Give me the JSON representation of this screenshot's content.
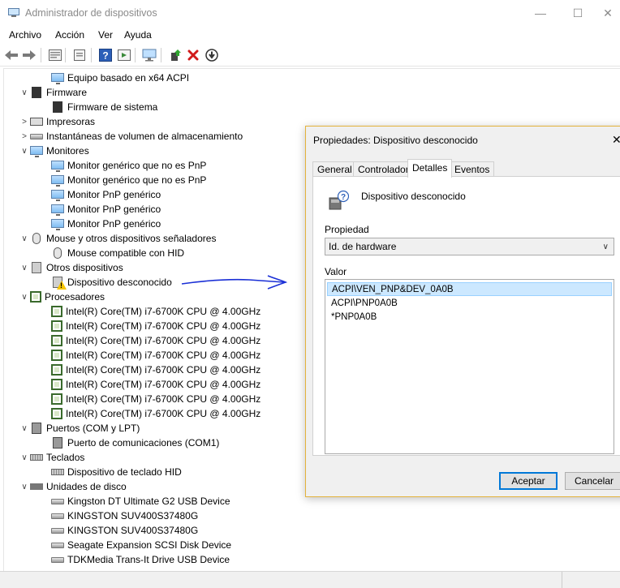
{
  "window": {
    "title": "Administrador de dispositivos",
    "minimize": "—",
    "maximize": "☐",
    "close": "✕"
  },
  "menu": [
    "Archivo",
    "Acción",
    "Ver",
    "Ayuda"
  ],
  "toolbar": [
    "back-icon",
    "forward-icon",
    "properties-icon",
    "refresh-icon",
    "help-icon",
    "run-icon",
    "monitor-icon",
    "update-driver-icon",
    "uninstall-icon",
    "download-icon"
  ],
  "tree": [
    {
      "label": "Equipo basado en x64 ACPI",
      "level": 2,
      "icon": "monitor",
      "expander": ""
    },
    {
      "label": "Firmware",
      "level": 1,
      "icon": "firmware",
      "expander": "∨"
    },
    {
      "label": "Firmware de sistema",
      "level": 2,
      "icon": "firmware",
      "expander": ""
    },
    {
      "label": "Impresoras",
      "level": 1,
      "icon": "printer",
      "expander": ">"
    },
    {
      "label": "Instantáneas de volumen de almacenamiento",
      "level": 1,
      "icon": "drive",
      "expander": ">"
    },
    {
      "label": "Monitores",
      "level": 1,
      "icon": "monitor",
      "expander": "∨"
    },
    {
      "label": "Monitor genérico que no es PnP",
      "level": 2,
      "icon": "monitor",
      "expander": ""
    },
    {
      "label": "Monitor genérico que no es PnP",
      "level": 2,
      "icon": "monitor",
      "expander": ""
    },
    {
      "label": "Monitor PnP genérico",
      "level": 2,
      "icon": "monitor",
      "expander": ""
    },
    {
      "label": "Monitor PnP genérico",
      "level": 2,
      "icon": "monitor",
      "expander": ""
    },
    {
      "label": "Monitor PnP genérico",
      "level": 2,
      "icon": "monitor",
      "expander": ""
    },
    {
      "label": "Mouse y otros dispositivos señaladores",
      "level": 1,
      "icon": "mouse",
      "expander": "∨"
    },
    {
      "label": "Mouse compatible con HID",
      "level": 2,
      "icon": "mouse",
      "expander": ""
    },
    {
      "label": "Otros dispositivos",
      "level": 1,
      "icon": "unknown",
      "expander": "∨"
    },
    {
      "label": "Dispositivo desconocido",
      "level": 2,
      "icon": "warning",
      "expander": ""
    },
    {
      "label": "Procesadores",
      "level": 1,
      "icon": "chip",
      "expander": "∨"
    },
    {
      "label": "Intel(R) Core(TM) i7-6700K CPU @ 4.00GHz",
      "level": 2,
      "icon": "chip",
      "expander": ""
    },
    {
      "label": "Intel(R) Core(TM) i7-6700K CPU @ 4.00GHz",
      "level": 2,
      "icon": "chip",
      "expander": ""
    },
    {
      "label": "Intel(R) Core(TM) i7-6700K CPU @ 4.00GHz",
      "level": 2,
      "icon": "chip",
      "expander": ""
    },
    {
      "label": "Intel(R) Core(TM) i7-6700K CPU @ 4.00GHz",
      "level": 2,
      "icon": "chip",
      "expander": ""
    },
    {
      "label": "Intel(R) Core(TM) i7-6700K CPU @ 4.00GHz",
      "level": 2,
      "icon": "chip",
      "expander": ""
    },
    {
      "label": "Intel(R) Core(TM) i7-6700K CPU @ 4.00GHz",
      "level": 2,
      "icon": "chip",
      "expander": ""
    },
    {
      "label": "Intel(R) Core(TM) i7-6700K CPU @ 4.00GHz",
      "level": 2,
      "icon": "chip",
      "expander": ""
    },
    {
      "label": "Intel(R) Core(TM) i7-6700K CPU @ 4.00GHz",
      "level": 2,
      "icon": "chip",
      "expander": ""
    },
    {
      "label": "Puertos (COM y LPT)",
      "level": 1,
      "icon": "port",
      "expander": "∨"
    },
    {
      "label": "Puerto de comunicaciones (COM1)",
      "level": 2,
      "icon": "port",
      "expander": ""
    },
    {
      "label": "Teclados",
      "level": 1,
      "icon": "keyboard",
      "expander": "∨"
    },
    {
      "label": "Dispositivo de teclado HID",
      "level": 2,
      "icon": "keyboard",
      "expander": ""
    },
    {
      "label": "Unidades de disco",
      "level": 1,
      "icon": "drive-row",
      "expander": "∨"
    },
    {
      "label": "Kingston DT Ultimate G2 USB Device",
      "level": 2,
      "icon": "drive",
      "expander": ""
    },
    {
      "label": "KINGSTON SUV400S37480G",
      "level": 2,
      "icon": "drive",
      "expander": ""
    },
    {
      "label": "KINGSTON SUV400S37480G",
      "level": 2,
      "icon": "drive",
      "expander": ""
    },
    {
      "label": "Seagate Expansion SCSI Disk Device",
      "level": 2,
      "icon": "drive",
      "expander": ""
    },
    {
      "label": "TDKMedia Trans-It Drive USB Device",
      "level": 2,
      "icon": "drive",
      "expander": ""
    }
  ],
  "dialog": {
    "title": "Propiedades: Dispositivo desconocido",
    "close": "✕",
    "tabs": [
      "General",
      "Controlador",
      "Detalles",
      "Eventos"
    ],
    "active_tab": "Detalles",
    "device_name": "Dispositivo desconocido",
    "property_label": "Propiedad",
    "property_value": "Id. de hardware",
    "value_label": "Valor",
    "values": [
      "ACPI\\VEN_PNP&DEV_0A0B",
      "ACPI\\PNP0A0B",
      "*PNP0A0B"
    ],
    "ok_label": "Aceptar",
    "cancel_label": "Cancelar"
  },
  "colors": {
    "accent": "#0078d7",
    "selection": "#cce8ff",
    "annotation": "#1a2fd6"
  }
}
